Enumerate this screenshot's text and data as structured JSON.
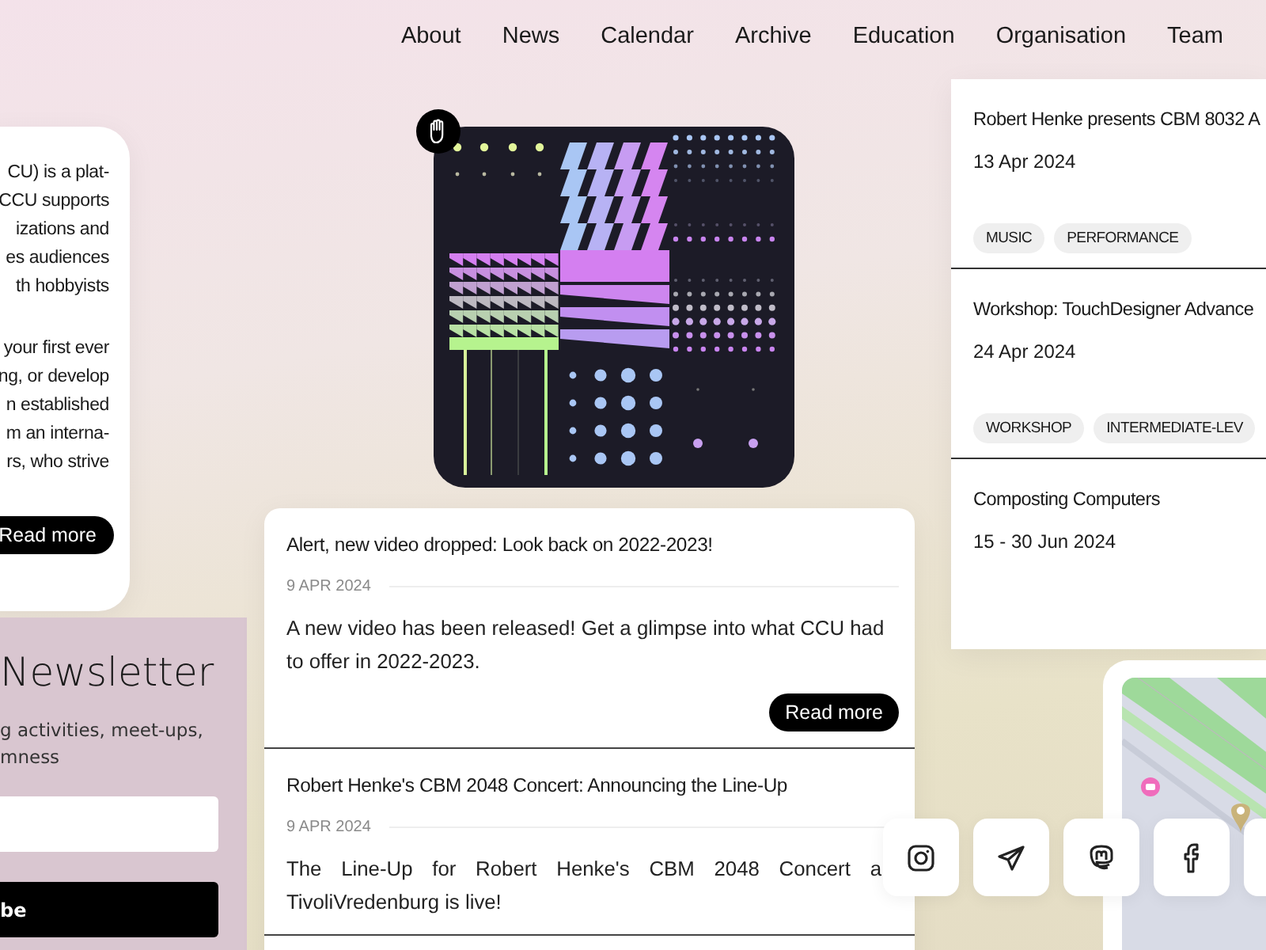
{
  "nav": [
    "About",
    "News",
    "Calendar",
    "Archive",
    "Education",
    "Organisation",
    "Team"
  ],
  "intro": {
    "paragraphs": [
      [
        "CU) is a plat-",
        "CCU supports",
        "izations and",
        "es audiences",
        "th hobbyists"
      ],
      [
        "your first ever",
        "ng, or develop",
        "n established",
        "m an interna-",
        "rs, who strive"
      ]
    ],
    "button": "Read more"
  },
  "newsletter": {
    "title": "Newsletter",
    "text_lines": [
      "g activities, meet-ups,",
      "mness"
    ],
    "button": "be"
  },
  "news": [
    {
      "title": "Alert, new video dropped: Look back on 2022-2023!",
      "date": "9 APR 2024",
      "body": [
        "A new video has been released! Get a glimpse into what CCU had",
        "to offer in 2022-2023."
      ],
      "button": "Read more"
    },
    {
      "title": "Robert Henke's CBM 2048 Concert: Announcing the Line-Up",
      "date": "9 APR 2024",
      "body": [
        "The Line-Up for Robert Henke's CBM 2048 Concert a",
        "TivoliVredenburg is live!"
      ]
    }
  ],
  "events": [
    {
      "title": "Robert Henke presents CBM 8032 A",
      "date": "13 Apr 2024",
      "tags": [
        "MUSIC",
        "PERFORMANCE"
      ]
    },
    {
      "title": "Workshop: TouchDesigner Advance",
      "date": "24 Apr 2024",
      "tags": [
        "WORKSHOP",
        "INTERMEDIATE-LEV"
      ]
    },
    {
      "title": "Composting Computers",
      "date": "15 - 30 Jun 2024"
    }
  ],
  "socials": [
    {
      "kind": "instagram"
    },
    {
      "kind": "telegram"
    },
    {
      "kind": "mastodon"
    },
    {
      "kind": "facebook"
    },
    {
      "kind": "other"
    }
  ]
}
